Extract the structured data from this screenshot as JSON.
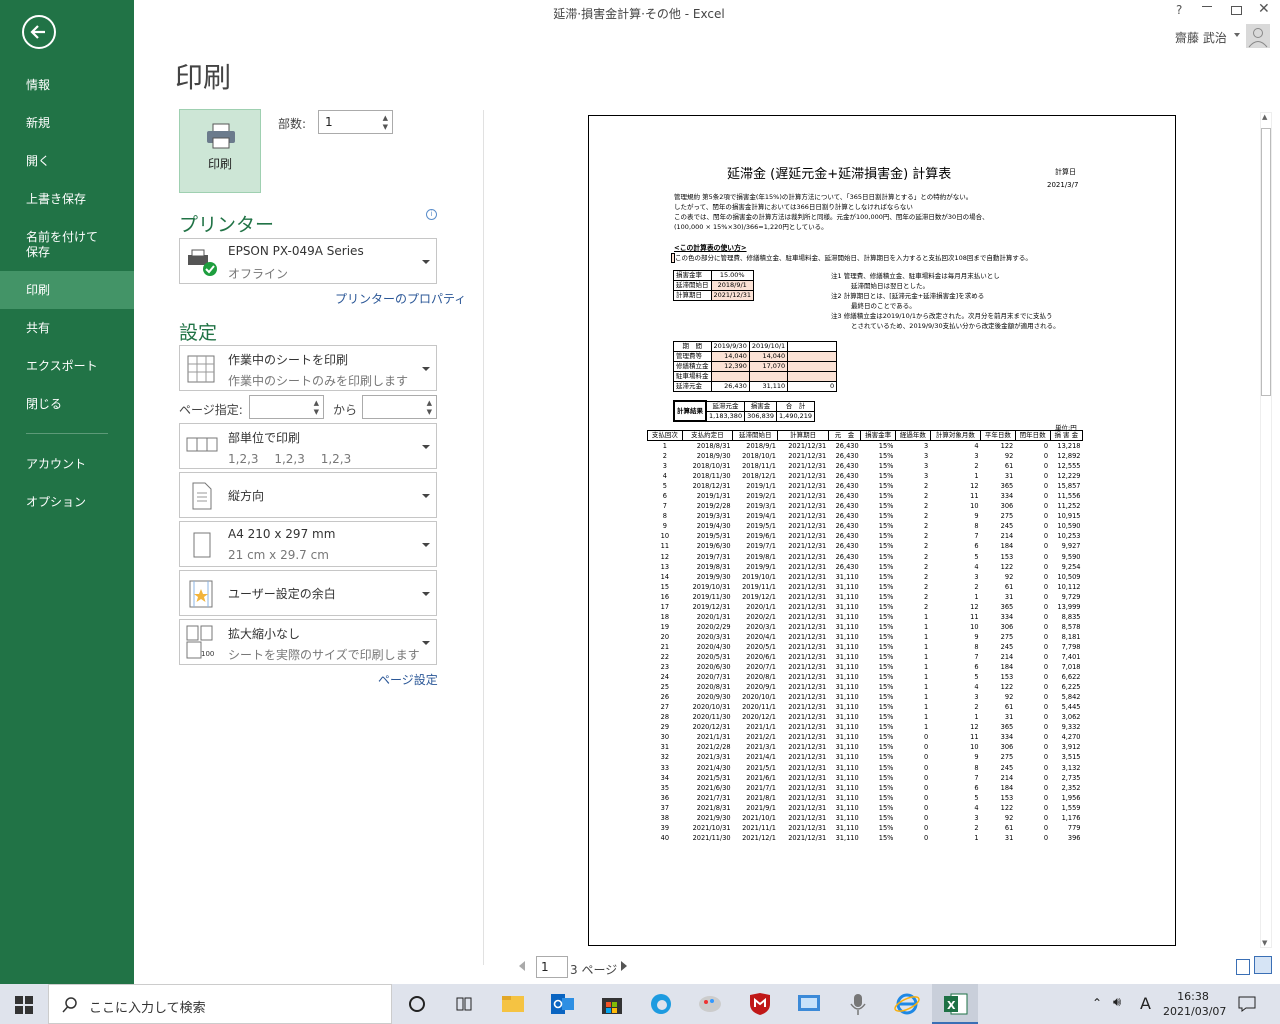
{
  "window": {
    "title": "延滞·損害金計算·その他 - Excel",
    "help": "?",
    "user": "齋藤 武治"
  },
  "sidebar": {
    "items": [
      {
        "label": "情報"
      },
      {
        "label": "新規"
      },
      {
        "label": "開く"
      },
      {
        "label": "上書き保存"
      },
      {
        "label": "名前を付けて保存"
      },
      {
        "label": "印刷"
      },
      {
        "label": "共有"
      },
      {
        "label": "エクスポート"
      },
      {
        "label": "閉じる"
      },
      {
        "label": "アカウント"
      },
      {
        "label": "オプション"
      }
    ]
  },
  "print": {
    "title": "印刷",
    "button": "印刷",
    "copies_label": "部数:",
    "copies": "1",
    "printer_heading": "プリンター",
    "printer_name": "EPSON PX-049A Series",
    "printer_status": "オフライン",
    "printer_props": "プリンターのプロパティ",
    "settings_heading": "設定",
    "opt_sheet": {
      "t1": "作業中のシートを印刷",
      "t2": "作業中のシートのみを印刷します"
    },
    "pages_label": "ページ指定:",
    "pages_to": "から",
    "opt_collate": {
      "t1": "部単位で印刷",
      "t2": "1,2,3　 1,2,3　 1,2,3"
    },
    "opt_orient": {
      "t1": "縦方向"
    },
    "opt_paper": {
      "t1": "A4 210 x 297 mm",
      "t2": "21 cm x 29.7 cm"
    },
    "opt_margin": {
      "t1": "ユーザー設定の余白"
    },
    "opt_scale": {
      "t1": "拡大縮小なし",
      "t2": "シートを実際のサイズで印刷します"
    },
    "page_setup": "ページ設定",
    "page_num": "1",
    "page_total": "3 ページ"
  },
  "doc": {
    "title": "延滞金 (遅延元金+延滞損害金) 計算表",
    "calc_date_label": "計算日",
    "calc_date": "2021/3/7",
    "intro": [
      "管理規約 第5条2項で損害金(年15%)の計算方法について、「365日日割計算とする」との特約がない。",
      "したがって、閏年の損害金計算においては366日日割り計算としなければならない",
      "この表では、閏年の損害金の計算方法は裁判所と同様。元金が100,000円、閏年の延滞日数が30日の場合、",
      "(100,000 × 15%×30)/366=1,220円としている。"
    ],
    "howto_title": "<この計算表の使い方>",
    "howto": "この色の部分に管理費、修繕積立金、駐車場料金、延滞開始日、計算期日を入力すると支払回次108回まで自動計算する。",
    "params": [
      [
        "損害金率",
        "15.00%"
      ],
      [
        "延滞開始日",
        "2018/9/1"
      ],
      [
        "計算期日",
        "2021/12/31"
      ]
    ],
    "notes": [
      "注1 管理費、修繕積立金、駐車場料金は毎月月末払いとし",
      "延滞開始日は翌日とした。",
      "注2 計算期日とは、[延滞元金+延滞損害金]を求める",
      "最終日のことである。",
      "注3 修繕積立金は2019/10/1から改定された。次月分を前月末までに支払う",
      "とされているため、2019/9/30支払い分から改定後金額が適用される。"
    ],
    "period": {
      "head": [
        "期　間",
        "2019/9/30",
        "2019/10/1",
        ""
      ],
      "rows": [
        [
          "管理費等",
          "14,040",
          "14,040",
          ""
        ],
        [
          "修繕積立金",
          "12,390",
          "17,070",
          ""
        ],
        [
          "駐車場料金",
          "",
          "",
          ""
        ],
        [
          "延滞元金",
          "26,430",
          "31,110",
          "0"
        ]
      ]
    },
    "result": {
      "label": "計算結果",
      "heads": [
        "延滞元金",
        "損害金",
        "合　計"
      ],
      "vals": [
        "1,183,380",
        "306,839",
        "1,490,219"
      ]
    },
    "unit": "単位:円",
    "headers": [
      "支払回次",
      "支払約定日",
      "延滞開始日",
      "計算期日",
      "元　金",
      "損害金率",
      "経過年数",
      "計算対象月数",
      "平年日数",
      "閏年日数",
      "損 害 金"
    ],
    "rows": [
      [
        "1",
        "2018/8/31",
        "2018/9/1",
        "2021/12/31",
        "26,430",
        "15%",
        "3",
        "4",
        "122",
        "0",
        "13,218"
      ],
      [
        "2",
        "2018/9/30",
        "2018/10/1",
        "2021/12/31",
        "26,430",
        "15%",
        "3",
        "3",
        "92",
        "0",
        "12,892"
      ],
      [
        "3",
        "2018/10/31",
        "2018/11/1",
        "2021/12/31",
        "26,430",
        "15%",
        "3",
        "2",
        "61",
        "0",
        "12,555"
      ],
      [
        "4",
        "2018/11/30",
        "2018/12/1",
        "2021/12/31",
        "26,430",
        "15%",
        "3",
        "1",
        "31",
        "0",
        "12,229"
      ],
      [
        "5",
        "2018/12/31",
        "2019/1/1",
        "2021/12/31",
        "26,430",
        "15%",
        "2",
        "12",
        "365",
        "0",
        "15,857"
      ],
      [
        "6",
        "2019/1/31",
        "2019/2/1",
        "2021/12/31",
        "26,430",
        "15%",
        "2",
        "11",
        "334",
        "0",
        "11,556"
      ],
      [
        "7",
        "2019/2/28",
        "2019/3/1",
        "2021/12/31",
        "26,430",
        "15%",
        "2",
        "10",
        "306",
        "0",
        "11,252"
      ],
      [
        "8",
        "2019/3/31",
        "2019/4/1",
        "2021/12/31",
        "26,430",
        "15%",
        "2",
        "9",
        "275",
        "0",
        "10,915"
      ],
      [
        "9",
        "2019/4/30",
        "2019/5/1",
        "2021/12/31",
        "26,430",
        "15%",
        "2",
        "8",
        "245",
        "0",
        "10,590"
      ],
      [
        "10",
        "2019/5/31",
        "2019/6/1",
        "2021/12/31",
        "26,430",
        "15%",
        "2",
        "7",
        "214",
        "0",
        "10,253"
      ],
      [
        "11",
        "2019/6/30",
        "2019/7/1",
        "2021/12/31",
        "26,430",
        "15%",
        "2",
        "6",
        "184",
        "0",
        "9,927"
      ],
      [
        "12",
        "2019/7/31",
        "2019/8/1",
        "2021/12/31",
        "26,430",
        "15%",
        "2",
        "5",
        "153",
        "0",
        "9,590"
      ],
      [
        "13",
        "2019/8/31",
        "2019/9/1",
        "2021/12/31",
        "26,430",
        "15%",
        "2",
        "4",
        "122",
        "0",
        "9,254"
      ],
      [
        "14",
        "2019/9/30",
        "2019/10/1",
        "2021/12/31",
        "31,110",
        "15%",
        "2",
        "3",
        "92",
        "0",
        "10,509"
      ],
      [
        "15",
        "2019/10/31",
        "2019/11/1",
        "2021/12/31",
        "31,110",
        "15%",
        "2",
        "2",
        "61",
        "0",
        "10,112"
      ],
      [
        "16",
        "2019/11/30",
        "2019/12/1",
        "2021/12/31",
        "31,110",
        "15%",
        "2",
        "1",
        "31",
        "0",
        "9,729"
      ],
      [
        "17",
        "2019/12/31",
        "2020/1/1",
        "2021/12/31",
        "31,110",
        "15%",
        "2",
        "12",
        "365",
        "0",
        "13,999"
      ],
      [
        "18",
        "2020/1/31",
        "2020/2/1",
        "2021/12/31",
        "31,110",
        "15%",
        "1",
        "11",
        "334",
        "0",
        "8,835"
      ],
      [
        "19",
        "2020/2/29",
        "2020/3/1",
        "2021/12/31",
        "31,110",
        "15%",
        "1",
        "10",
        "306",
        "0",
        "8,578"
      ],
      [
        "20",
        "2020/3/31",
        "2020/4/1",
        "2021/12/31",
        "31,110",
        "15%",
        "1",
        "9",
        "275",
        "0",
        "8,181"
      ],
      [
        "21",
        "2020/4/30",
        "2020/5/1",
        "2021/12/31",
        "31,110",
        "15%",
        "1",
        "8",
        "245",
        "0",
        "7,798"
      ],
      [
        "22",
        "2020/5/31",
        "2020/6/1",
        "2021/12/31",
        "31,110",
        "15%",
        "1",
        "7",
        "214",
        "0",
        "7,401"
      ],
      [
        "23",
        "2020/6/30",
        "2020/7/1",
        "2021/12/31",
        "31,110",
        "15%",
        "1",
        "6",
        "184",
        "0",
        "7,018"
      ],
      [
        "24",
        "2020/7/31",
        "2020/8/1",
        "2021/12/31",
        "31,110",
        "15%",
        "1",
        "5",
        "153",
        "0",
        "6,622"
      ],
      [
        "25",
        "2020/8/31",
        "2020/9/1",
        "2021/12/31",
        "31,110",
        "15%",
        "1",
        "4",
        "122",
        "0",
        "6,225"
      ],
      [
        "26",
        "2020/9/30",
        "2020/10/1",
        "2021/12/31",
        "31,110",
        "15%",
        "1",
        "3",
        "92",
        "0",
        "5,842"
      ],
      [
        "27",
        "2020/10/31",
        "2020/11/1",
        "2021/12/31",
        "31,110",
        "15%",
        "1",
        "2",
        "61",
        "0",
        "5,445"
      ],
      [
        "28",
        "2020/11/30",
        "2020/12/1",
        "2021/12/31",
        "31,110",
        "15%",
        "1",
        "1",
        "31",
        "0",
        "3,062"
      ],
      [
        "29",
        "2020/12/31",
        "2021/1/1",
        "2021/12/31",
        "31,110",
        "15%",
        "1",
        "12",
        "365",
        "0",
        "9,332"
      ],
      [
        "30",
        "2021/1/31",
        "2021/2/1",
        "2021/12/31",
        "31,110",
        "15%",
        "0",
        "11",
        "334",
        "0",
        "4,270"
      ],
      [
        "31",
        "2021/2/28",
        "2021/3/1",
        "2021/12/31",
        "31,110",
        "15%",
        "0",
        "10",
        "306",
        "0",
        "3,912"
      ],
      [
        "32",
        "2021/3/31",
        "2021/4/1",
        "2021/12/31",
        "31,110",
        "15%",
        "0",
        "9",
        "275",
        "0",
        "3,515"
      ],
      [
        "33",
        "2021/4/30",
        "2021/5/1",
        "2021/12/31",
        "31,110",
        "15%",
        "0",
        "8",
        "245",
        "0",
        "3,132"
      ],
      [
        "34",
        "2021/5/31",
        "2021/6/1",
        "2021/12/31",
        "31,110",
        "15%",
        "0",
        "7",
        "214",
        "0",
        "2,735"
      ],
      [
        "35",
        "2021/6/30",
        "2021/7/1",
        "2021/12/31",
        "31,110",
        "15%",
        "0",
        "6",
        "184",
        "0",
        "2,352"
      ],
      [
        "36",
        "2021/7/31",
        "2021/8/1",
        "2021/12/31",
        "31,110",
        "15%",
        "0",
        "5",
        "153",
        "0",
        "1,956"
      ],
      [
        "37",
        "2021/8/31",
        "2021/9/1",
        "2021/12/31",
        "31,110",
        "15%",
        "0",
        "4",
        "122",
        "0",
        "1,559"
      ],
      [
        "38",
        "2021/9/30",
        "2021/10/1",
        "2021/12/31",
        "31,110",
        "15%",
        "0",
        "3",
        "92",
        "0",
        "1,176"
      ],
      [
        "39",
        "2021/10/31",
        "2021/11/1",
        "2021/12/31",
        "31,110",
        "15%",
        "0",
        "2",
        "61",
        "0",
        "779"
      ],
      [
        "40",
        "2021/11/30",
        "2021/12/1",
        "2021/12/31",
        "31,110",
        "15%",
        "0",
        "1",
        "31",
        "0",
        "396"
      ]
    ]
  },
  "taskbar": {
    "search_placeholder": "ここに入力して検索",
    "time": "16:38",
    "date": "2021/03/07",
    "ime": "A"
  }
}
